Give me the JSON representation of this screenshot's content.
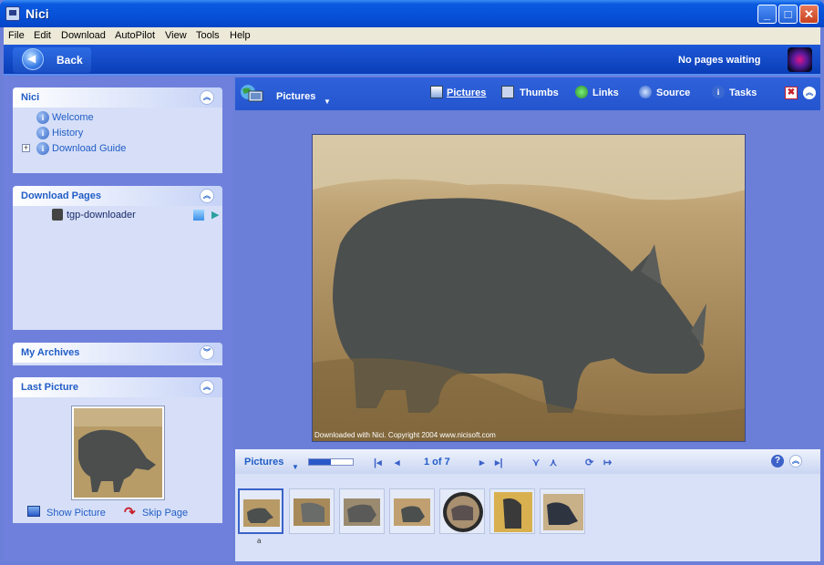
{
  "window": {
    "title": "Nici"
  },
  "menu": [
    "File",
    "Edit",
    "Download",
    "AutoPilot",
    "View",
    "Tools",
    "Help"
  ],
  "commandbar": {
    "back_label": "Back",
    "status": "No pages waiting"
  },
  "panels": {
    "nici": {
      "title": "Nici",
      "items": [
        "Welcome",
        "History",
        "Download Guide"
      ]
    },
    "download_pages": {
      "title": "Download Pages",
      "items": [
        "tgp-downloader"
      ]
    },
    "my_archives": {
      "title": "My Archives"
    },
    "last_picture": {
      "title": "Last Picture",
      "show_label": "Show Picture",
      "skip_label": "Skip Page"
    }
  },
  "viewer": {
    "view_label": "Pictures",
    "tabs": [
      "Pictures",
      "Thumbs",
      "Links",
      "Source",
      "Tasks"
    ],
    "active_tab": "Pictures",
    "caption": "Downloaded with Nici. Copyright 2004 www.nicisoft.com"
  },
  "thumbbar": {
    "label": "Pictures",
    "page_count": "1 of 7",
    "progress": 0.5
  },
  "thumbnails": {
    "count": 7,
    "selected_index": 0,
    "selected_marker": "a"
  },
  "colors": {
    "accent": "#215dc6",
    "titlebar": "#0650d8",
    "panel": "#d6dff7"
  }
}
